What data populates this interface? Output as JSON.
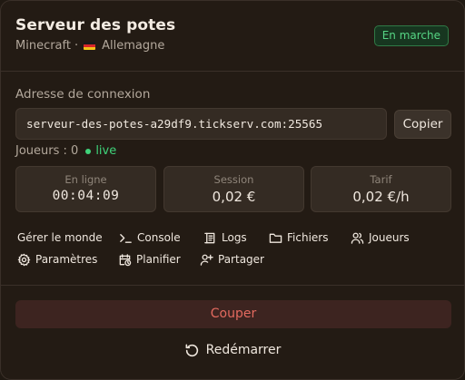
{
  "header": {
    "title": "Serveur des potes",
    "game": "Minecraft",
    "separator": "·",
    "location": "Allemagne",
    "flag_icon": "germany-flag-icon",
    "status_badge": "En marche",
    "status_color": "#56d584"
  },
  "connection": {
    "label": "Adresse de connexion",
    "address": "serveur-des-potes-a29df9.tickserv.com:25565",
    "copy_label": "Copier"
  },
  "players": {
    "label": "Joueurs : 0",
    "live_label": "live",
    "live_color": "#3fd27a"
  },
  "stats": [
    {
      "label": "En ligne",
      "value": "00:04:09"
    },
    {
      "label": "Session",
      "value": "0,02 €"
    },
    {
      "label": "Tarif",
      "value": "0,02 €/h"
    }
  ],
  "actions": {
    "manage_world": "Gérer le monde",
    "console": "Console",
    "logs": "Logs",
    "files": "Fichiers",
    "players": "Joueurs",
    "settings": "Paramètres",
    "schedule": "Planifier",
    "share": "Partager"
  },
  "footer": {
    "stop_label": "Couper",
    "stop_color": "#e36a5f",
    "restart_label": "Redémarrer"
  }
}
